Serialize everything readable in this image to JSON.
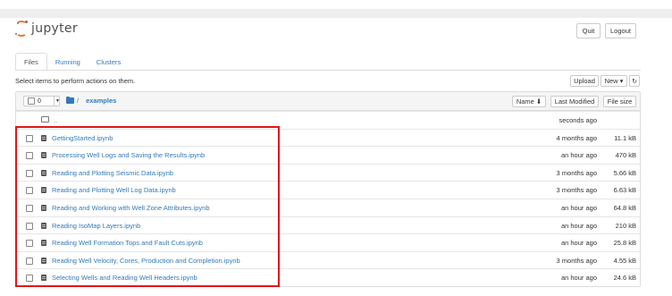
{
  "header": {
    "logo_text": "jupyter",
    "quit_label": "Quit",
    "logout_label": "Logout"
  },
  "tabs": [
    {
      "label": "Files",
      "active": true
    },
    {
      "label": "Running",
      "active": false
    },
    {
      "label": "Clusters",
      "active": false
    }
  ],
  "toolbar": {
    "hint": "Select items to perform actions on them.",
    "upload_label": "Upload",
    "new_label": "New ▾",
    "refresh_icon": "refresh-icon"
  },
  "list_header": {
    "selected_count": "0",
    "breadcrumb_sep": "/",
    "breadcrumb_folder": "examples",
    "name_label": "Name ⬇",
    "last_modified_label": "Last Modified",
    "file_size_label": "File size"
  },
  "parent_row": {
    "name": "..",
    "modified": "seconds ago"
  },
  "files": [
    {
      "name": "GettingStarted.ipynb",
      "modified": "4 months ago",
      "size": "11.1 kB"
    },
    {
      "name": "Processing Well Logs and Saving the Results.ipynb",
      "modified": "an hour ago",
      "size": "470 kB"
    },
    {
      "name": "Reading and Plotting Seismic Data.ipynb",
      "modified": "3 months ago",
      "size": "5.66 kB"
    },
    {
      "name": "Reading and Plotting Well Log Data.ipynb",
      "modified": "3 months ago",
      "size": "6.63 kB"
    },
    {
      "name": "Reading and Working with Well Zone Attributes.ipynb",
      "modified": "an hour ago",
      "size": "64.8 kB"
    },
    {
      "name": "Reading IsoMap Layers.ipynb",
      "modified": "an hour ago",
      "size": "210 kB"
    },
    {
      "name": "Reading Well Formation Tops and Fault Cuts.ipynb",
      "modified": "an hour ago",
      "size": "25.8 kB"
    },
    {
      "name": "Reading Well Velocity, Cores, Production and Completion.ipynb",
      "modified": "3 months ago",
      "size": "4.55 kB"
    },
    {
      "name": "Selecting Wells and Reading Well Headers.ipynb",
      "modified": "an hour ago",
      "size": "24.6 kB"
    }
  ],
  "colors": {
    "accent": "#337ab7",
    "logo_orange": "#f37726",
    "highlight": "#e0161b"
  }
}
